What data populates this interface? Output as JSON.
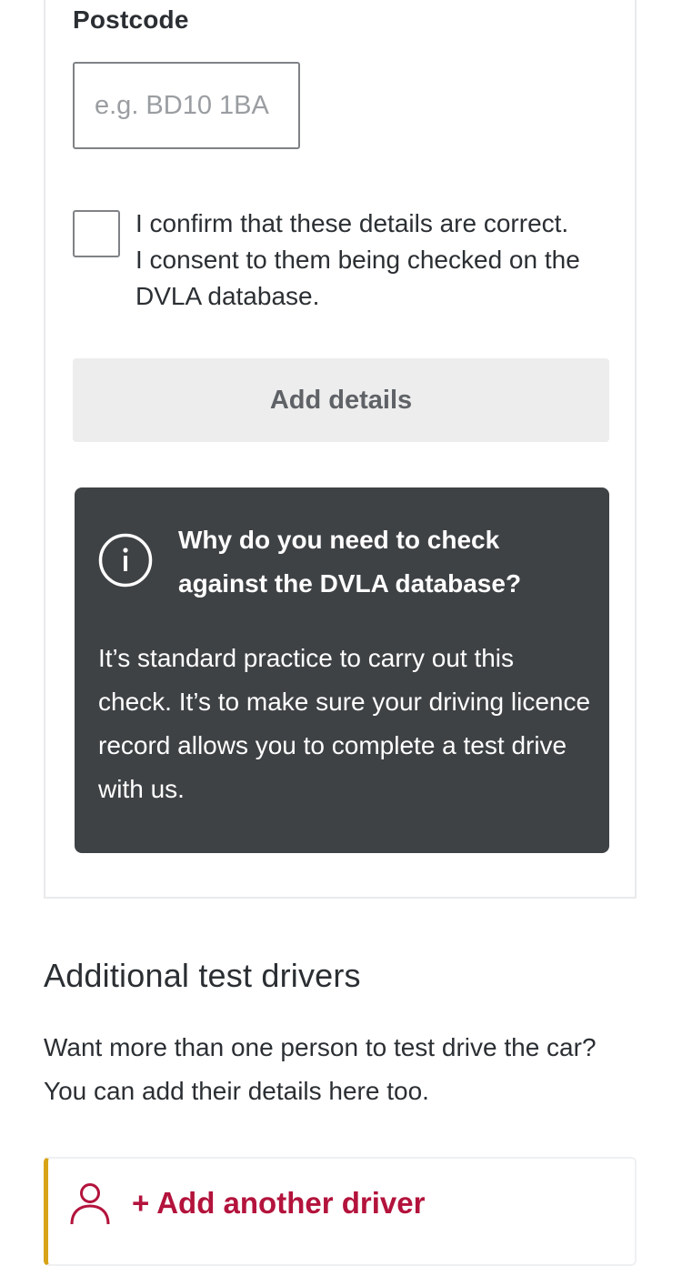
{
  "postcode": {
    "label": "Postcode",
    "placeholder": "e.g. BD10 1BA",
    "value": ""
  },
  "consent": {
    "checked": false,
    "text": "I confirm that these details are correct. I consent to them being checked on the DVLA database."
  },
  "add_details_button": {
    "label": "Add details",
    "state": "disabled"
  },
  "info_panel": {
    "icon": "info-icon",
    "title": "Why do you need to check against the DVLA database?",
    "body": "It’s standard practice to carry out this check. It’s to make sure your driving licence record allows you to complete a test drive with us."
  },
  "additional_drivers": {
    "title": "Additional test drivers",
    "description": "Want more than one person to test drive the car? You can add their details here too.",
    "add_driver_label": "+ Add another driver",
    "add_driver_icon": "person-icon"
  },
  "colors": {
    "info_panel_bg": "#3f4245",
    "accent_red": "#b3133c",
    "accent_yellow": "#d8a317",
    "button_disabled_bg": "#ededed"
  }
}
